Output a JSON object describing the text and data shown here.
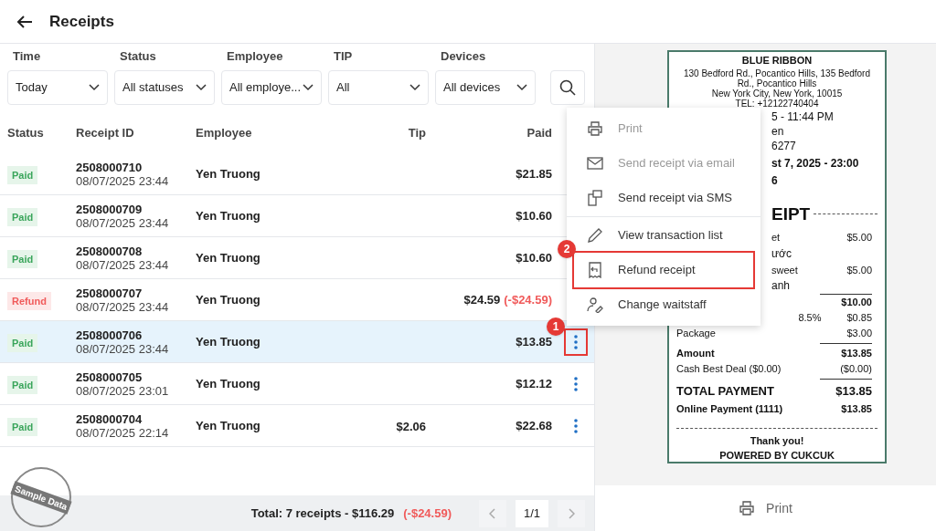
{
  "header": {
    "title": "Receipts"
  },
  "filters": [
    {
      "label": "Time",
      "value": "Today"
    },
    {
      "label": "Status",
      "value": "All statuses"
    },
    {
      "label": "Employee",
      "value": "All employe..."
    },
    {
      "label": "TIP",
      "value": "All"
    },
    {
      "label": "Devices",
      "value": "All devices"
    }
  ],
  "table": {
    "columns": [
      "Status",
      "Receipt ID",
      "Employee",
      "Tip",
      "Paid"
    ],
    "rows": [
      {
        "status": "Paid",
        "kind": "paid",
        "id": "2508000710",
        "time": "08/07/2025 23:44",
        "employee": "Yen Truong",
        "paid": "$21.85",
        "selected": false
      },
      {
        "status": "Paid",
        "kind": "paid",
        "id": "2508000709",
        "time": "08/07/2025 23:44",
        "employee": "Yen Truong",
        "paid": "$10.60",
        "selected": false
      },
      {
        "status": "Paid",
        "kind": "paid",
        "id": "2508000708",
        "time": "08/07/2025 23:44",
        "employee": "Yen Truong",
        "paid": "$10.60",
        "selected": false
      },
      {
        "status": "Refund",
        "kind": "refund",
        "id": "2508000707",
        "time": "08/07/2025 23:44",
        "employee": "Yen Truong",
        "paid": "$24.59",
        "refund": "(-$24.59)",
        "selected": false
      },
      {
        "status": "Paid",
        "kind": "paid",
        "id": "2508000706",
        "time": "08/07/2025 23:44",
        "employee": "Yen Truong",
        "paid": "$13.85",
        "selected": true,
        "actions_visible": true,
        "callout": "1"
      },
      {
        "status": "Paid",
        "kind": "paid",
        "id": "2508000705",
        "time": "08/07/2025 23:01",
        "employee": "Yen Truong",
        "paid": "$12.12",
        "selected": false,
        "actions_visible": true
      },
      {
        "status": "Paid",
        "kind": "paid",
        "id": "2508000704",
        "time": "08/07/2025 22:14",
        "employee": "Yen Truong",
        "tip": "$2.06",
        "paid": "$22.68",
        "selected": false,
        "actions_visible": true
      }
    ]
  },
  "footer": {
    "total": "Total: 7 receipts - $116.29",
    "refund": "(-$24.59)",
    "page": "1/1"
  },
  "stamp": "Sample Data",
  "context_menu": [
    {
      "label": "Print",
      "disabled": true
    },
    {
      "label": "Send receipt via email",
      "disabled": true
    },
    {
      "label": "Send receipt via SMS",
      "disabled": false
    },
    {
      "label": "View transaction list",
      "disabled": false
    },
    {
      "label": "Refund receipt",
      "disabled": false,
      "callout": "2"
    },
    {
      "label": "Change waitstaff",
      "disabled": false
    }
  ],
  "receipt": {
    "header": [
      "BLUE RIBBON",
      "130 Bedford Rd., Pocantico Hills, 135 Bedford Rd., Pocantico Hills",
      "New York City, New York, 10015",
      "TEL: +12122740404"
    ],
    "lines": [
      {
        "kind": "fragment",
        "text": "5 - 11:44 PM"
      },
      {
        "kind": "fragment",
        "text": "en"
      },
      {
        "kind": "fragment",
        "text": "6277"
      },
      {
        "kind": "fragment-bold",
        "text": "st 7, 2025 - 23:00"
      },
      {
        "kind": "fragment-bold",
        "text": "6"
      },
      {
        "kind": "title",
        "text": "EIPT"
      },
      {
        "kind": "item",
        "text": "et",
        "amount": "$5.00"
      },
      {
        "kind": "fragment",
        "text": "ước"
      },
      {
        "kind": "item",
        "text": "sweet",
        "amount": "$5.00"
      },
      {
        "kind": "fragment",
        "text": "anh"
      },
      {
        "kind": "rule"
      },
      {
        "kind": "subtotal",
        "amount": "$10.00"
      },
      {
        "kind": "tax",
        "rate": "8.5%",
        "amount": "$0.85"
      },
      {
        "kind": "row",
        "text": "Package",
        "amount": "$3.00"
      },
      {
        "kind": "rule"
      },
      {
        "kind": "row-bold",
        "text": "Amount",
        "amount": "$13.85"
      },
      {
        "kind": "row",
        "text": "Cash Best Deal ($0.00)",
        "amount": "($0.00)"
      },
      {
        "kind": "rule"
      },
      {
        "kind": "total",
        "text": "TOTAL PAYMENT",
        "amount": "$13.85"
      },
      {
        "kind": "row-bold",
        "text": "Online Payment (1111)",
        "amount": "$13.85"
      },
      {
        "kind": "dashed"
      },
      {
        "kind": "center-bold",
        "text": "Thank you!"
      },
      {
        "kind": "center-bold",
        "text": "POWERED BY CUKCUK"
      }
    ]
  },
  "preview_footer": {
    "button": "Print"
  }
}
